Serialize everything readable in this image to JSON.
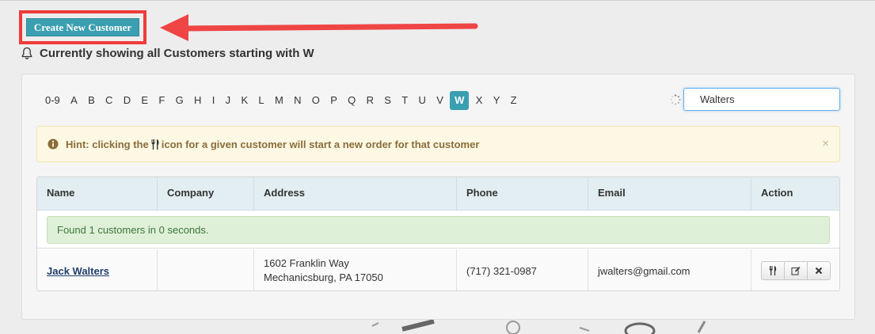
{
  "create_button": {
    "label": "Create New Customer"
  },
  "status": {
    "text": "Currently showing all Customers starting with W"
  },
  "alphabet": {
    "letters": [
      "0-9",
      "A",
      "B",
      "C",
      "D",
      "E",
      "F",
      "G",
      "H",
      "I",
      "J",
      "K",
      "L",
      "M",
      "N",
      "O",
      "P",
      "Q",
      "R",
      "S",
      "T",
      "U",
      "V",
      "W",
      "X",
      "Y",
      "Z"
    ],
    "active": "W"
  },
  "search": {
    "value": "Walters"
  },
  "hint": {
    "prefix": "Hint: clicking the",
    "suffix": "icon for a given customer will start a new order for that customer",
    "close": "×"
  },
  "table": {
    "columns": [
      "Name",
      "Company",
      "Address",
      "Phone",
      "Email",
      "Action"
    ],
    "found_text": "Found 1 customers in 0 seconds.",
    "rows": [
      {
        "name": "Jack Walters",
        "company": "",
        "address_line1": "1602 Franklin Way",
        "address_line2": "Mechanicsburg, PA 17050",
        "phone": "(717) 321-0987",
        "email": "jwalters@gmail.com",
        "actions": [
          "new-order-icon",
          "edit-icon",
          "delete-icon"
        ]
      }
    ]
  },
  "colors": {
    "accent": "#3a9fb0",
    "annotation_red": "#ef3b3b",
    "hint_bg": "#fcf8e3",
    "success_bg": "#dff0d8",
    "header_bg": "#e3eef2"
  }
}
